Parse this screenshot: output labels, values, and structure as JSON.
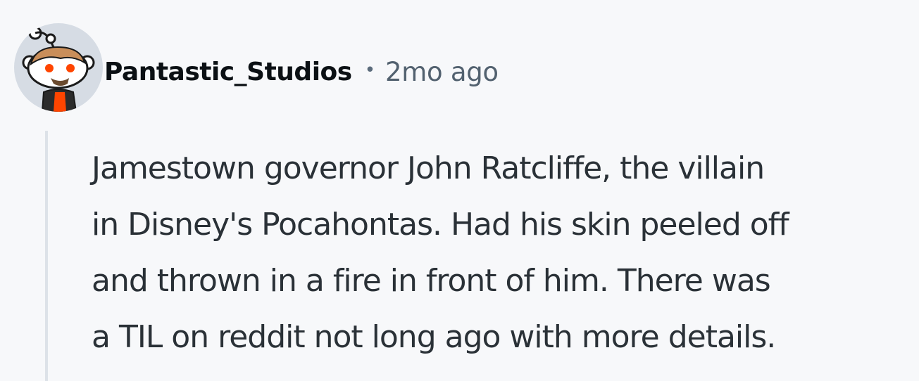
{
  "comment": {
    "username": "Pantastic_Studios",
    "separator": "•",
    "timestamp": "2mo ago",
    "body": "Jamestown governor John Ratcliffe, the villain\nin Disney's Pocahontas. Had his skin peeled off\nand thrown in a fire in front of him. There was\na TIL on reddit not long ago with more details.",
    "avatar_icon": "snoo-avatar-icon"
  },
  "colors": {
    "background": "#f7f8fa",
    "username": "#0b1014",
    "meta": "#52616f",
    "body_text": "#2a3137",
    "thread_line": "#dde2e8",
    "avatar_bg": "#d6dce4",
    "avatar_accent": "#ff4500"
  }
}
